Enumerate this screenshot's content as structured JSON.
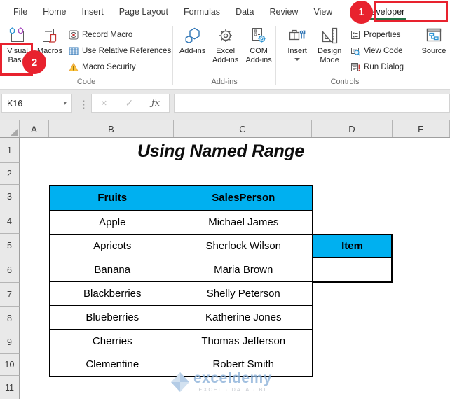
{
  "ribbon": {
    "tabs": [
      "File",
      "Home",
      "Insert",
      "Page Layout",
      "Formulas",
      "Data",
      "Review",
      "View",
      "Developer"
    ],
    "active_tab": "Developer",
    "groups": {
      "code": {
        "label": "Code",
        "visual_basic": "Visual Basic",
        "macros": "Macros",
        "items": [
          "Record Macro",
          "Use Relative References",
          "Macro Security"
        ]
      },
      "addins": {
        "label": "Add-ins",
        "buttons": [
          "Add-ins",
          "Excel Add-ins",
          "COM Add-ins"
        ]
      },
      "controls": {
        "label": "Controls",
        "insert": "Insert",
        "design_mode": "Design Mode",
        "items": [
          "Properties",
          "View Code",
          "Run Dialog"
        ]
      },
      "xml": {
        "source": "Source"
      }
    }
  },
  "annotations": {
    "step_1": "1",
    "step_2": "2"
  },
  "formula_bar": {
    "name_box": "K16",
    "formula": ""
  },
  "icons": {
    "namebox_arrow_glyph": "▾",
    "separator_glyph": "⋮",
    "cancel_glyph": "×",
    "enter_glyph": "✓",
    "function_glyph": "ƒx"
  },
  "sheet": {
    "title": "Using Named Range",
    "columns": [
      "A",
      "B",
      "C",
      "D",
      "E"
    ],
    "rows": [
      "1",
      "2",
      "3",
      "4",
      "5",
      "6",
      "7",
      "8",
      "9",
      "10",
      "11"
    ],
    "table": {
      "headers": [
        "Fruits",
        "SalesPerson"
      ],
      "rows": [
        [
          "Apple",
          "Michael James"
        ],
        [
          "Apricots",
          "Sherlock Wilson"
        ],
        [
          "Banana",
          "Maria Brown"
        ],
        [
          "Blackberries",
          "Shelly Peterson"
        ],
        [
          "Blueberries",
          "Katherine Jones"
        ],
        [
          "Cherries",
          "Thomas Jefferson"
        ],
        [
          "Clementine",
          "Robert Smith"
        ]
      ]
    },
    "lookup": {
      "header": "Item",
      "value": ""
    }
  },
  "watermark": {
    "brand": "exceldemy",
    "tagline": "EXCEL · DATA · BI"
  },
  "colors": {
    "table_header_fill": "#00b0f0",
    "annotation_red": "#e8222e",
    "active_tab_underline": "#217346"
  }
}
